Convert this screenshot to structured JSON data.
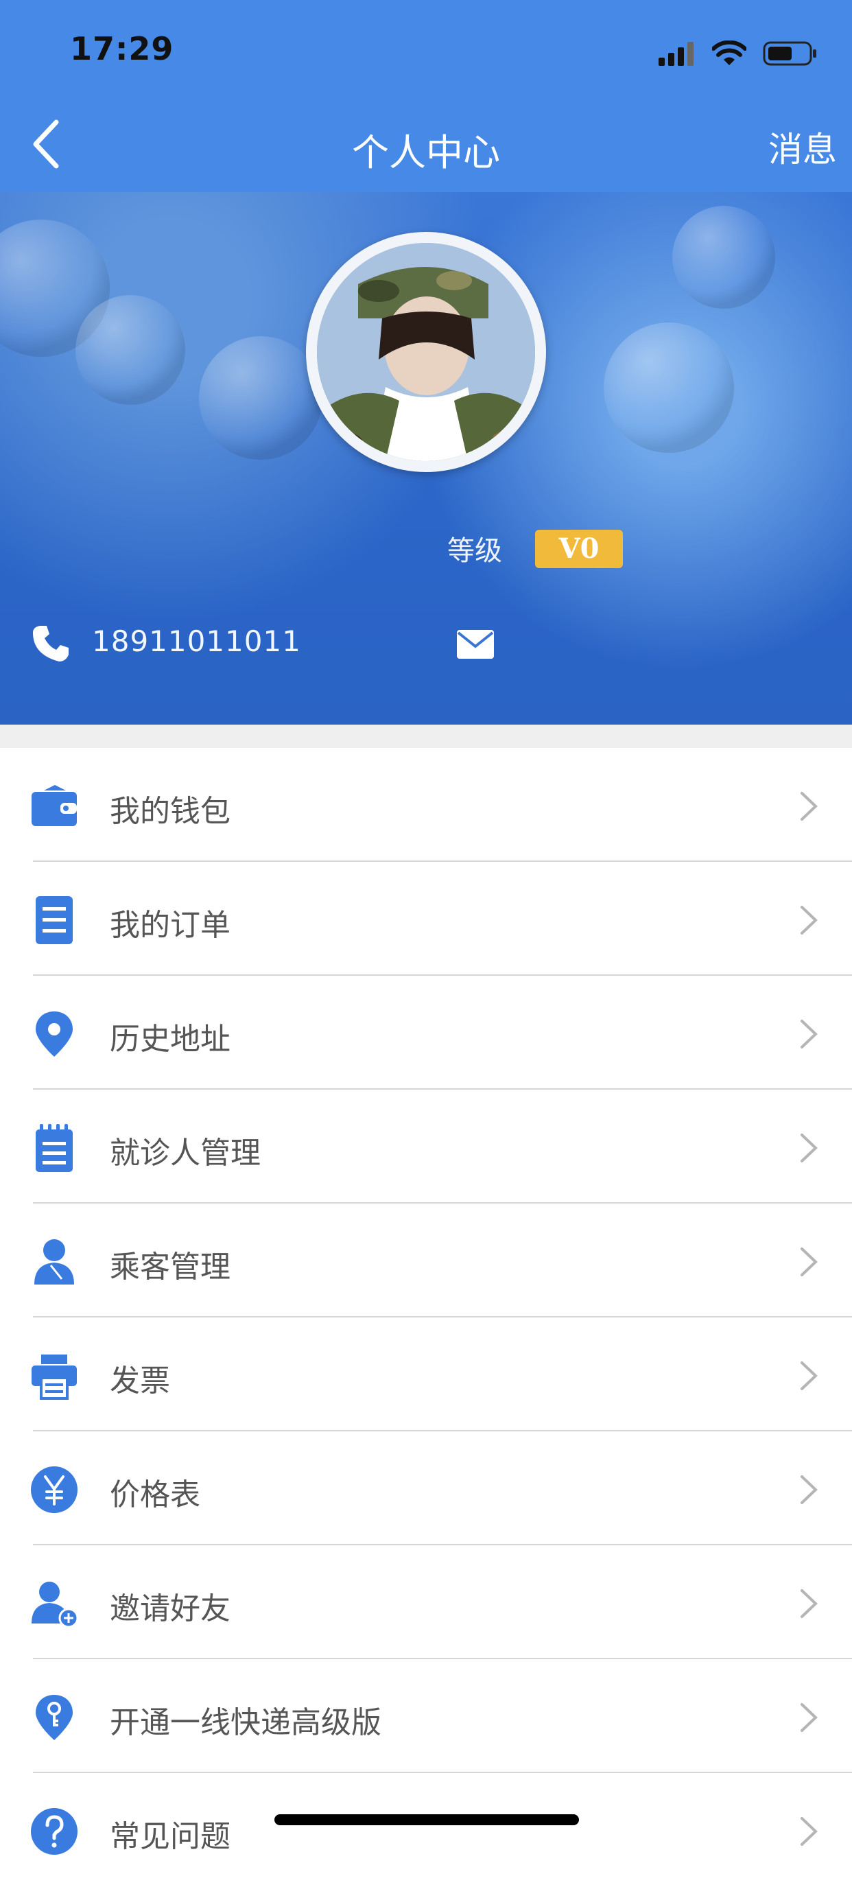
{
  "status_bar": {
    "time": "17:29"
  },
  "header": {
    "title": "个人中心",
    "messages_label": "消息"
  },
  "profile": {
    "level_label": "等级",
    "level_value": "V0",
    "phone": "18911011011"
  },
  "menu": [
    {
      "label": "我的钱包",
      "icon": "wallet-icon"
    },
    {
      "label": "我的订单",
      "icon": "order-list-icon"
    },
    {
      "label": "历史地址",
      "icon": "location-pin-icon"
    },
    {
      "label": "就诊人管理",
      "icon": "notepad-icon"
    },
    {
      "label": "乘客管理",
      "icon": "person-icon"
    },
    {
      "label": "发票",
      "icon": "printer-icon"
    },
    {
      "label": "价格表",
      "icon": "yen-icon"
    },
    {
      "label": "邀请好友",
      "icon": "add-user-icon"
    },
    {
      "label": "开通一线快递高级版",
      "icon": "key-pin-icon"
    },
    {
      "label": "常见问题",
      "icon": "question-icon"
    }
  ],
  "colors": {
    "nav": "#4689e6",
    "accent": "#3a7be0",
    "badge": "#f1ba3b"
  }
}
